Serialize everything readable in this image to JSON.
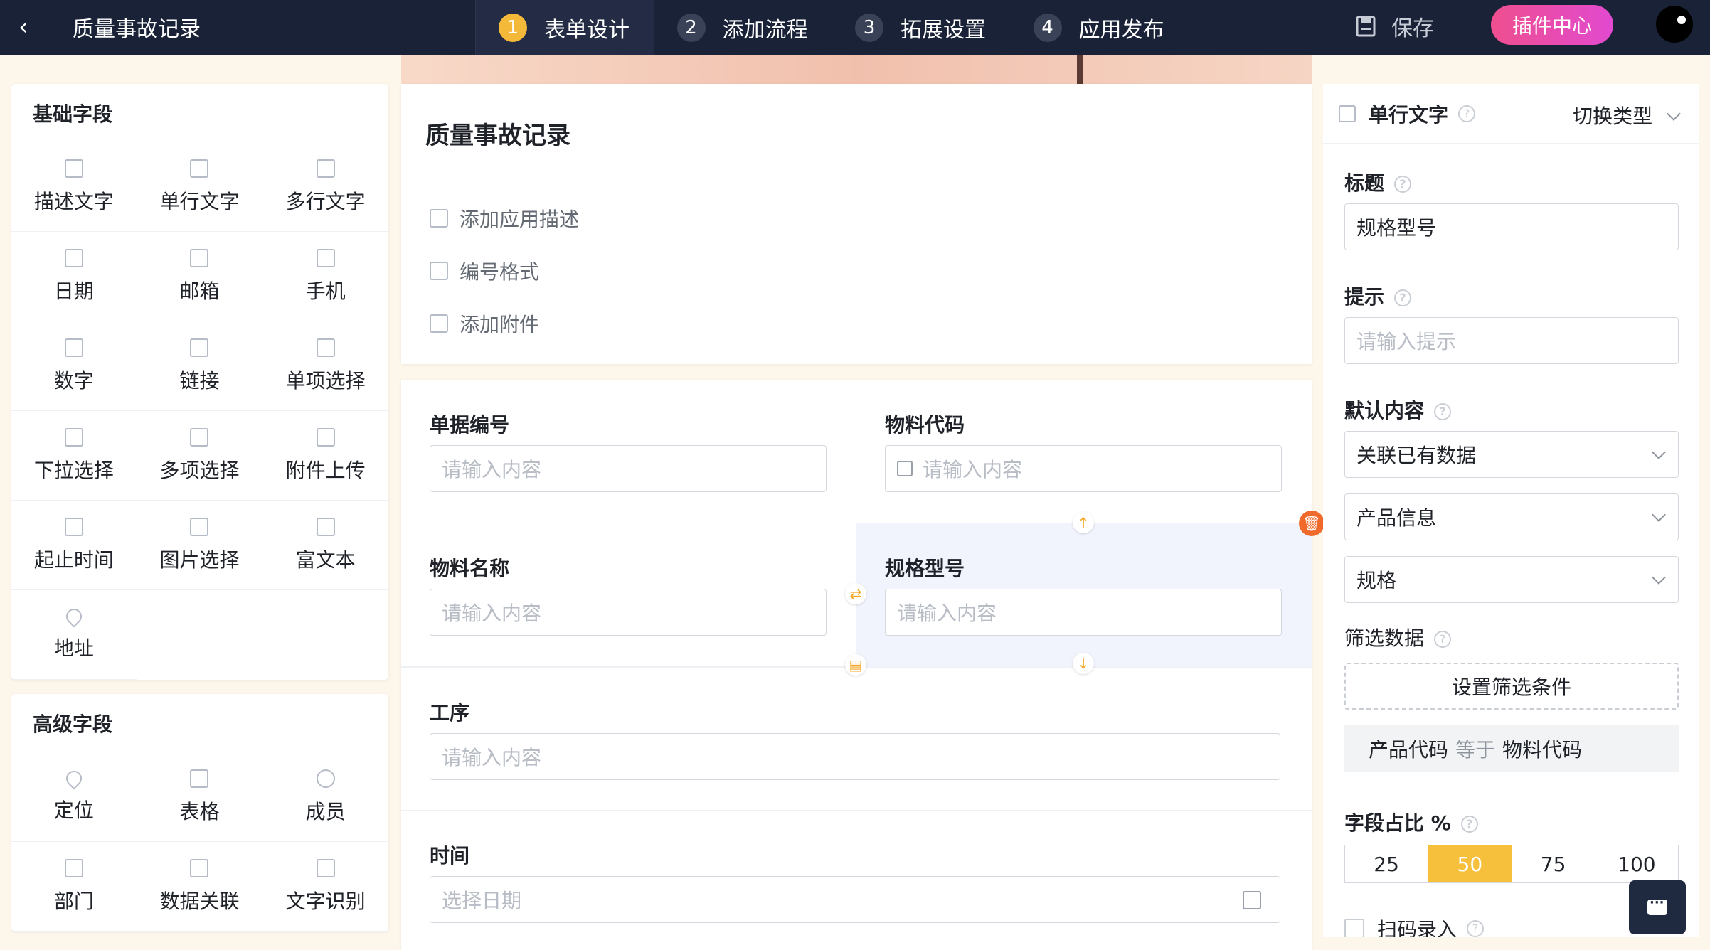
{
  "topbar": {
    "back_glyph": "‹",
    "title": "质量事故记录",
    "steps": [
      {
        "num": "1",
        "label": "表单设计"
      },
      {
        "num": "2",
        "label": "添加流程"
      },
      {
        "num": "3",
        "label": "拓展设置"
      },
      {
        "num": "4",
        "label": "应用发布"
      }
    ],
    "active_step": 0,
    "save_label": "保存",
    "plugin_label": "插件中心"
  },
  "basic_fields": {
    "title": "基础字段",
    "items": [
      "描述文字",
      "单行文字",
      "多行文字",
      "日期",
      "邮箱",
      "手机",
      "数字",
      "链接",
      "单项选择",
      "下拉选择",
      "多项选择",
      "附件上传",
      "起止时间",
      "图片选择",
      "富文本",
      "地址"
    ]
  },
  "advanced_fields": {
    "title": "高级字段",
    "items": [
      "定位",
      "表格",
      "成员",
      "部门",
      "数据关联",
      "文字识别"
    ]
  },
  "form": {
    "title": "质量事故记录",
    "actions": [
      "添加应用描述",
      "编号格式",
      "添加附件"
    ],
    "fields": {
      "f1": {
        "label": "单据编号",
        "placeholder": "请输入内容"
      },
      "f2": {
        "label": "物料代码",
        "placeholder": "请输入内容"
      },
      "f3": {
        "label": "物料名称",
        "placeholder": "请输入内容"
      },
      "f4": {
        "label": "规格型号",
        "placeholder": "请输入内容"
      },
      "f5": {
        "label": "工序",
        "placeholder": "请输入内容"
      },
      "f6": {
        "label": "时间",
        "placeholder": "选择日期"
      }
    }
  },
  "props": {
    "type_label": "单行文字",
    "switch_label": "切换类型",
    "help_glyph": "?",
    "title_label": "标题",
    "title_value": "规格型号",
    "hint_label": "提示",
    "hint_placeholder": "请输入提示",
    "default_label": "默认内容",
    "default_value": "关联已有数据",
    "source_value": "产品信息",
    "field_value": "规格",
    "filter_label": "筛选数据",
    "filter_button": "设置筛选条件",
    "filter_cond": {
      "left": "产品代码",
      "op": "等于",
      "right": "物料代码"
    },
    "ratio_label": "字段占比 %",
    "ratio_options": [
      "25",
      "50",
      "75",
      "100"
    ],
    "ratio_selected": "50",
    "scan_label": "扫码录入"
  },
  "colors": {
    "topbar": "#1a2238",
    "accent": "#f7c03c",
    "plugin_start": "#ef4f8f",
    "plugin_end": "#e14ad0",
    "delete": "#f06a2c"
  }
}
